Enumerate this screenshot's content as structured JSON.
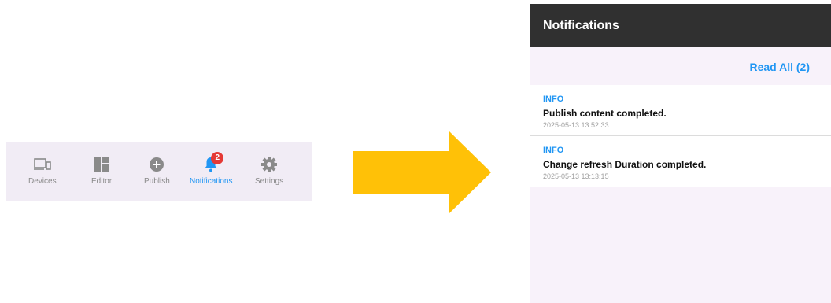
{
  "bottom_nav": {
    "items": [
      {
        "label": "Devices",
        "icon": "devices-icon",
        "active": false
      },
      {
        "label": "Editor",
        "icon": "editor-icon",
        "active": false
      },
      {
        "label": "Publish",
        "icon": "publish-icon",
        "active": false
      },
      {
        "label": "Notifications",
        "icon": "bell-icon",
        "active": true,
        "badge": "2"
      },
      {
        "label": "Settings",
        "icon": "gear-icon",
        "active": false
      }
    ]
  },
  "arrow": {
    "color": "#ffc107"
  },
  "notifications_panel": {
    "title": "Notifications",
    "read_all_label": "Read All (2)",
    "items": [
      {
        "level": "INFO",
        "message": "Publish content completed.",
        "timestamp": "2025-05-13 13:52:33"
      },
      {
        "level": "INFO",
        "message": "Change refresh Duration completed.",
        "timestamp": "2025-05-13 13:13:15"
      }
    ]
  },
  "colors": {
    "accent": "#2196f3",
    "badge": "#e53935",
    "header_bg": "#303030",
    "nav_bg": "#f1ecf5"
  }
}
